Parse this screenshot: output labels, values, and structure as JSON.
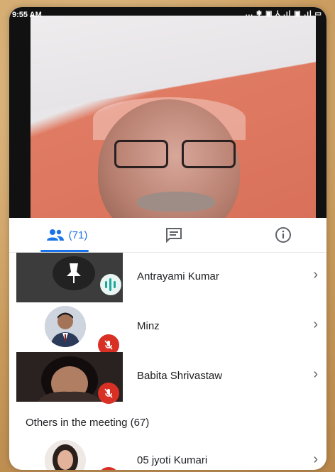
{
  "status": {
    "time": "9:55 AM",
    "icons": "... ✱ ▣ ⅄ .ıl ▣ .ıl ▭"
  },
  "tabs": {
    "people_count": "(71)",
    "people_icon": "people-icon",
    "chat_icon": "chat-icon",
    "info_icon": "info-icon",
    "accent_color": "#1a73e8"
  },
  "participants": [
    {
      "name": "Antrayami Kumar",
      "state": "speaking"
    },
    {
      "name": "Minz",
      "state": "muted"
    },
    {
      "name": "Babita Shrivastaw",
      "state": "muted"
    }
  ],
  "others": {
    "label": "Others in the meeting (67)",
    "first": {
      "name": "05 jyoti Kumari"
    }
  }
}
